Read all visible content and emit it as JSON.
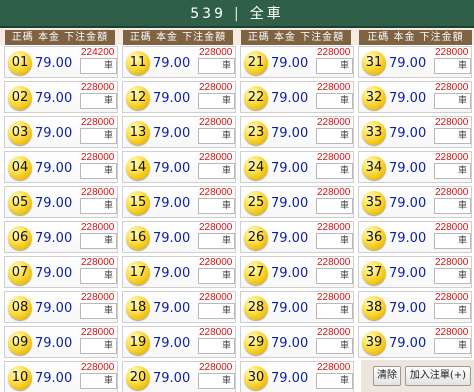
{
  "header": {
    "title_game": "539",
    "title_separator": "|",
    "title_mode": "全車"
  },
  "column_header": "正碼 本金 下注金額",
  "columns": [
    {
      "cells": [
        {
          "num": "01",
          "odds": "79.00",
          "cap": "224200"
        },
        {
          "num": "02",
          "odds": "79.00",
          "cap": "228000"
        },
        {
          "num": "03",
          "odds": "79.00",
          "cap": "228000"
        },
        {
          "num": "04",
          "odds": "79.00",
          "cap": "228000"
        },
        {
          "num": "05",
          "odds": "79.00",
          "cap": "228000"
        },
        {
          "num": "06",
          "odds": "79.00",
          "cap": "228000"
        },
        {
          "num": "07",
          "odds": "79.00",
          "cap": "228000"
        },
        {
          "num": "08",
          "odds": "79.00",
          "cap": "228000"
        },
        {
          "num": "09",
          "odds": "79.00",
          "cap": "228000"
        },
        {
          "num": "10",
          "odds": "79.00",
          "cap": "228000"
        }
      ]
    },
    {
      "cells": [
        {
          "num": "11",
          "odds": "79.00",
          "cap": "228000"
        },
        {
          "num": "12",
          "odds": "79.00",
          "cap": "228000"
        },
        {
          "num": "13",
          "odds": "79.00",
          "cap": "228000"
        },
        {
          "num": "14",
          "odds": "79.00",
          "cap": "228000"
        },
        {
          "num": "15",
          "odds": "79.00",
          "cap": "228000"
        },
        {
          "num": "16",
          "odds": "79.00",
          "cap": "228000"
        },
        {
          "num": "17",
          "odds": "79.00",
          "cap": "228000"
        },
        {
          "num": "18",
          "odds": "79.00",
          "cap": "228000"
        },
        {
          "num": "19",
          "odds": "79.00",
          "cap": "228000"
        },
        {
          "num": "20",
          "odds": "79.00",
          "cap": "228000"
        }
      ]
    },
    {
      "cells": [
        {
          "num": "21",
          "odds": "79.00",
          "cap": "228000"
        },
        {
          "num": "22",
          "odds": "79.00",
          "cap": "228000"
        },
        {
          "num": "23",
          "odds": "79.00",
          "cap": "228000"
        },
        {
          "num": "24",
          "odds": "79.00",
          "cap": "228000"
        },
        {
          "num": "25",
          "odds": "79.00",
          "cap": "228000"
        },
        {
          "num": "26",
          "odds": "79.00",
          "cap": "228000"
        },
        {
          "num": "27",
          "odds": "79.00",
          "cap": "228000"
        },
        {
          "num": "28",
          "odds": "79.00",
          "cap": "228000"
        },
        {
          "num": "29",
          "odds": "79.00",
          "cap": "228000"
        },
        {
          "num": "30",
          "odds": "79.00",
          "cap": "228000"
        }
      ]
    },
    {
      "cells": [
        {
          "num": "31",
          "odds": "79.00",
          "cap": "228000"
        },
        {
          "num": "32",
          "odds": "79.00",
          "cap": "228000"
        },
        {
          "num": "33",
          "odds": "79.00",
          "cap": "228000"
        },
        {
          "num": "34",
          "odds": "79.00",
          "cap": "228000"
        },
        {
          "num": "35",
          "odds": "79.00",
          "cap": "228000"
        },
        {
          "num": "36",
          "odds": "79.00",
          "cap": "228000"
        },
        {
          "num": "37",
          "odds": "79.00",
          "cap": "228000"
        },
        {
          "num": "38",
          "odds": "79.00",
          "cap": "228000"
        },
        {
          "num": "39",
          "odds": "79.00",
          "cap": "228000"
        }
      ]
    }
  ],
  "input_placeholder": "車",
  "buttons": {
    "clear": "清除",
    "add_to_slip": "加入注單(+)"
  },
  "colors": {
    "title_bg": "#2f5f47",
    "header_bg": "#7e6242",
    "odds_text": "#0b1fa0",
    "cap_text": "#d01515",
    "ball": "#f1c20f"
  }
}
